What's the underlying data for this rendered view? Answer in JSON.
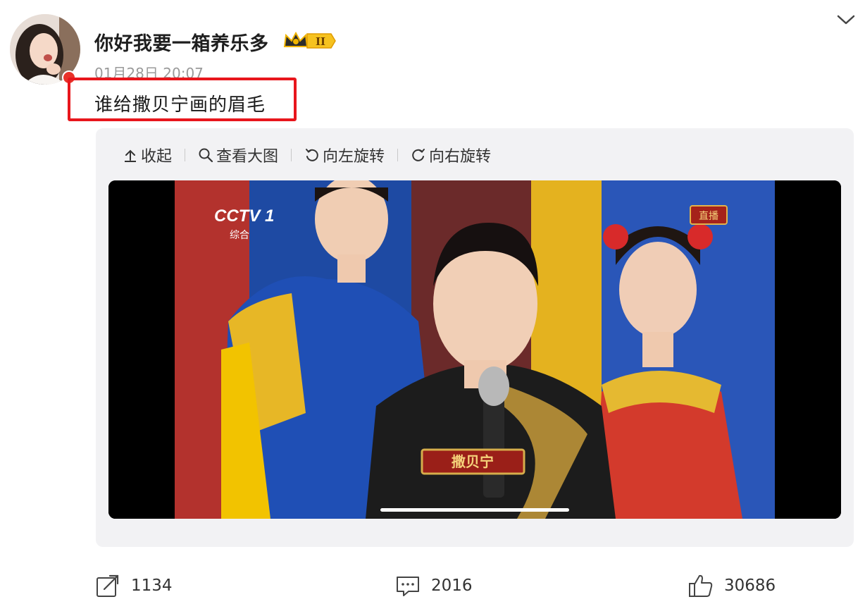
{
  "post": {
    "username": "你好我要一箱养乐多",
    "vip_level": "II",
    "timestamp": "01月28日 20:07",
    "text": "谁给撒贝宁画的眉毛"
  },
  "toolbar": {
    "collapse": "收起",
    "view_large": "查看大图",
    "rotate_left": "向左旋转",
    "rotate_right": "向右旋转"
  },
  "image": {
    "channel_logo": "CCTV 1",
    "channel_sub": "综合",
    "live_tag": "直播",
    "name_plate": "撒贝宁"
  },
  "actions": {
    "repost_count": "1134",
    "comment_count": "2016",
    "like_count": "30686"
  },
  "colors": {
    "highlight": "#e8161c",
    "panel_bg": "#f2f2f4",
    "badge_gold": "#f0b400"
  },
  "icons": {
    "chevron": "chevron-down-icon",
    "collapse": "collapse-up-icon",
    "view_large": "search-icon",
    "rotate_left": "rotate-left-icon",
    "rotate_right": "rotate-right-icon",
    "repost": "repost-icon",
    "comment": "comment-icon",
    "like": "thumbs-up-icon"
  }
}
